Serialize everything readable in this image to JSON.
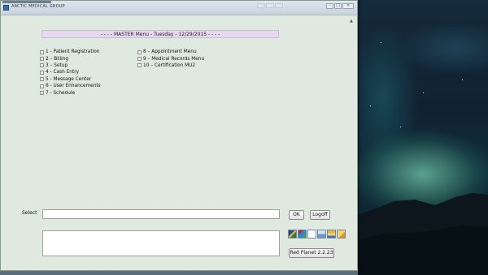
{
  "window": {
    "title": "ARCTIC MEDICAL GROUP"
  },
  "header": {
    "text": "- - - - MASTER Menu - Tuesday - 12/29/2015 - - - -"
  },
  "menu": {
    "left": [
      {
        "label": "1 - Patient Registration"
      },
      {
        "label": "2 – Billing"
      },
      {
        "label": "3 – Setup"
      },
      {
        "label": "4 - Cash Entry"
      },
      {
        "label": "5 - Message Center"
      },
      {
        "label": "6 - User Enhancements"
      },
      {
        "label": "7 - Schedule"
      }
    ],
    "right": [
      {
        "label": "8 – Appointment Menu"
      },
      {
        "label": "9 – Medical Records Menu"
      },
      {
        "label": "10 – Certification MU2"
      }
    ]
  },
  "select": {
    "label": "Select",
    "value": ""
  },
  "buttons": {
    "ok": "OK",
    "logoff": "Logoff",
    "version": "Red Planet 2.2.23"
  },
  "toolbar_icons": [
    "palette-icon",
    "color-grid-icon",
    "blank-page-icon",
    "window-icon",
    "chart-icon",
    "folder-icon"
  ]
}
